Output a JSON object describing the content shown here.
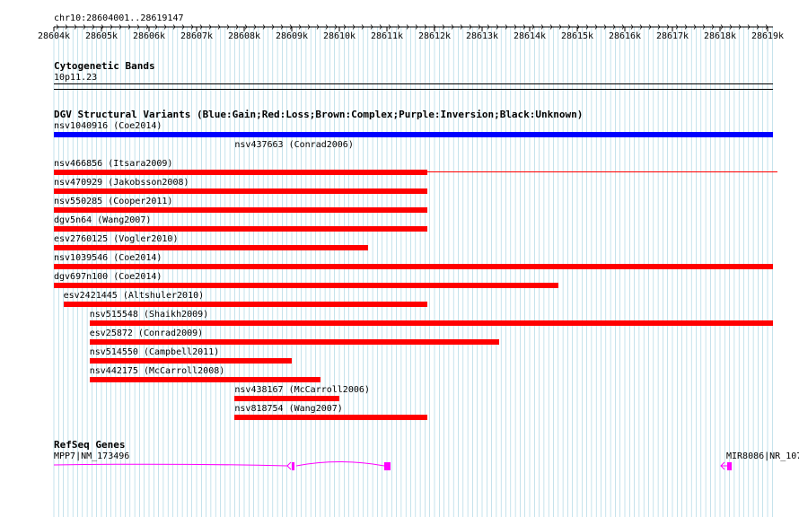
{
  "track_colors": {
    "gain": "#0000ff",
    "loss": "#ff0000",
    "complex": "#a52a2a",
    "inversion": "#800080",
    "unknown": "#000000",
    "refseq": "#ff00ff",
    "gridline": "#a0d0e0"
  },
  "ruler": {
    "position_label": "chr10:28604001..28619147",
    "ticks": [
      "28604k",
      "28605k",
      "28606k",
      "28607k",
      "28608k",
      "28609k",
      "28610k",
      "28611k",
      "28612k",
      "28613k",
      "28614k",
      "28615k",
      "28616k",
      "28617k",
      "28618k",
      "28619k"
    ]
  },
  "cytoband": {
    "title": "Cytogenetic Bands",
    "band": "10p11.23"
  },
  "dgv": {
    "title": "DGV Structural Variants (Blue:Gain;Red:Loss;Brown:Complex;Purple:Inversion;Black:Unknown)",
    "variants": [
      {
        "label": "nsv1040916 (Coe2014)",
        "type": "gain",
        "start_kb": 28604.0,
        "end_kb": 28619.2,
        "bar_start_kb": 28604.0
      },
      {
        "label": "nsv437663 (Conrad2006)",
        "type": "loss",
        "start_kb": 28604.0,
        "end_kb": 28619.2,
        "bar_start_kb": 28607.8,
        "bar_end_kb": 28610.0,
        "thin": true
      },
      {
        "label": "nsv466856 (Itsara2009)",
        "type": "loss",
        "start_kb": 28604.0,
        "end_kb": 28611.85,
        "bar_start_kb": 28604.0
      },
      {
        "label": "nsv470929 (Jakobsson2008)",
        "type": "loss",
        "start_kb": 28604.0,
        "end_kb": 28611.85,
        "bar_start_kb": 28604.0
      },
      {
        "label": "nsv550285 (Cooper2011)",
        "type": "loss",
        "start_kb": 28604.0,
        "end_kb": 28611.85,
        "bar_start_kb": 28604.0
      },
      {
        "label": "dgv5n64 (Wang2007)",
        "type": "loss",
        "start_kb": 28604.0,
        "end_kb": 28611.85,
        "bar_start_kb": 28604.0
      },
      {
        "label": "esv2760125 (Vogler2010)",
        "type": "loss",
        "start_kb": 28604.0,
        "end_kb": 28610.6,
        "bar_start_kb": 28604.0
      },
      {
        "label": "nsv1039546 (Coe2014)",
        "type": "loss",
        "start_kb": 28604.0,
        "end_kb": 28619.2,
        "bar_start_kb": 28604.0
      },
      {
        "label": "dgv697n100 (Coe2014)",
        "type": "loss",
        "start_kb": 28604.0,
        "end_kb": 28614.6,
        "bar_start_kb": 28604.0
      },
      {
        "label": "esv2421445 (Altshuler2010)",
        "type": "loss",
        "start_kb": 28604.2,
        "end_kb": 28611.85,
        "bar_start_kb": 28604.2
      },
      {
        "label": "nsv515548 (Shaikh2009)",
        "type": "loss",
        "start_kb": 28604.75,
        "end_kb": 28619.2,
        "bar_start_kb": 28604.75
      },
      {
        "label": "esv25872 (Conrad2009)",
        "type": "loss",
        "start_kb": 28604.75,
        "end_kb": 28613.35,
        "bar_start_kb": 28604.75
      },
      {
        "label": "nsv514550 (Campbell2011)",
        "type": "loss",
        "start_kb": 28604.75,
        "end_kb": 28609.0,
        "bar_start_kb": 28604.75
      },
      {
        "label": "nsv442175 (McCarroll2008)",
        "type": "loss",
        "start_kb": 28604.75,
        "end_kb": 28609.6,
        "bar_start_kb": 28604.75
      },
      {
        "label": "nsv438167 (McCarroll2006)",
        "type": "loss",
        "start_kb": 28607.8,
        "end_kb": 28610.0,
        "bar_start_kb": 28607.8
      },
      {
        "label": "nsv818754 (Wang2007)",
        "type": "loss",
        "start_kb": 28607.8,
        "end_kb": 28611.85,
        "bar_start_kb": 28607.8
      }
    ]
  },
  "refseq": {
    "title": "RefSeq Genes",
    "genes": [
      {
        "label": "MPP7|NM_173496"
      },
      {
        "label": "MIR8086|NR_107"
      }
    ]
  }
}
